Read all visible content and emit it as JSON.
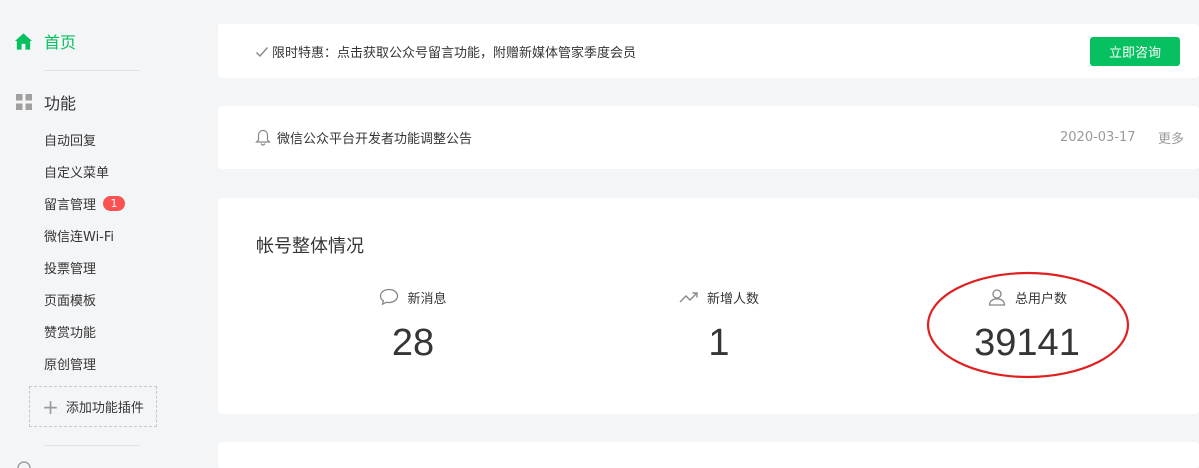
{
  "colors": {
    "accent": "#07c160",
    "badge": "#fa5151",
    "annotation": "#e02020",
    "background": "#f4f5f7",
    "muted_text": "#9a9a9a"
  },
  "sidebar": {
    "home_label": "首页",
    "home_icon": "home-icon",
    "section_label": "功能",
    "section_icon": "grid-icon",
    "items": [
      {
        "label": "自动回复"
      },
      {
        "label": "自定义菜单"
      },
      {
        "label": "留言管理",
        "badge": "1"
      },
      {
        "label": "微信连Wi-Fi"
      },
      {
        "label": "投票管理"
      },
      {
        "label": "页面模板"
      },
      {
        "label": "赞赏功能"
      },
      {
        "label": "原创管理"
      }
    ],
    "add_plugin_label": "添加功能插件"
  },
  "promo": {
    "text": "限时特惠：点击获取公众号留言功能，附赠新媒体管家季度会员",
    "icon": "check-icon",
    "button_label": "立即咨询"
  },
  "notice": {
    "icon": "bell-icon",
    "text": "微信公众平台开发者功能调整公告",
    "date": "2020-03-17",
    "more_label": "更多"
  },
  "overview": {
    "title": "帐号整体情况",
    "stats": [
      {
        "label": "新消息",
        "icon": "chat-bubble-icon",
        "value": "28"
      },
      {
        "label": "新增人数",
        "icon": "trend-up-icon",
        "value": "1"
      },
      {
        "label": "总用户数",
        "icon": "user-icon",
        "value": "39141"
      }
    ]
  }
}
